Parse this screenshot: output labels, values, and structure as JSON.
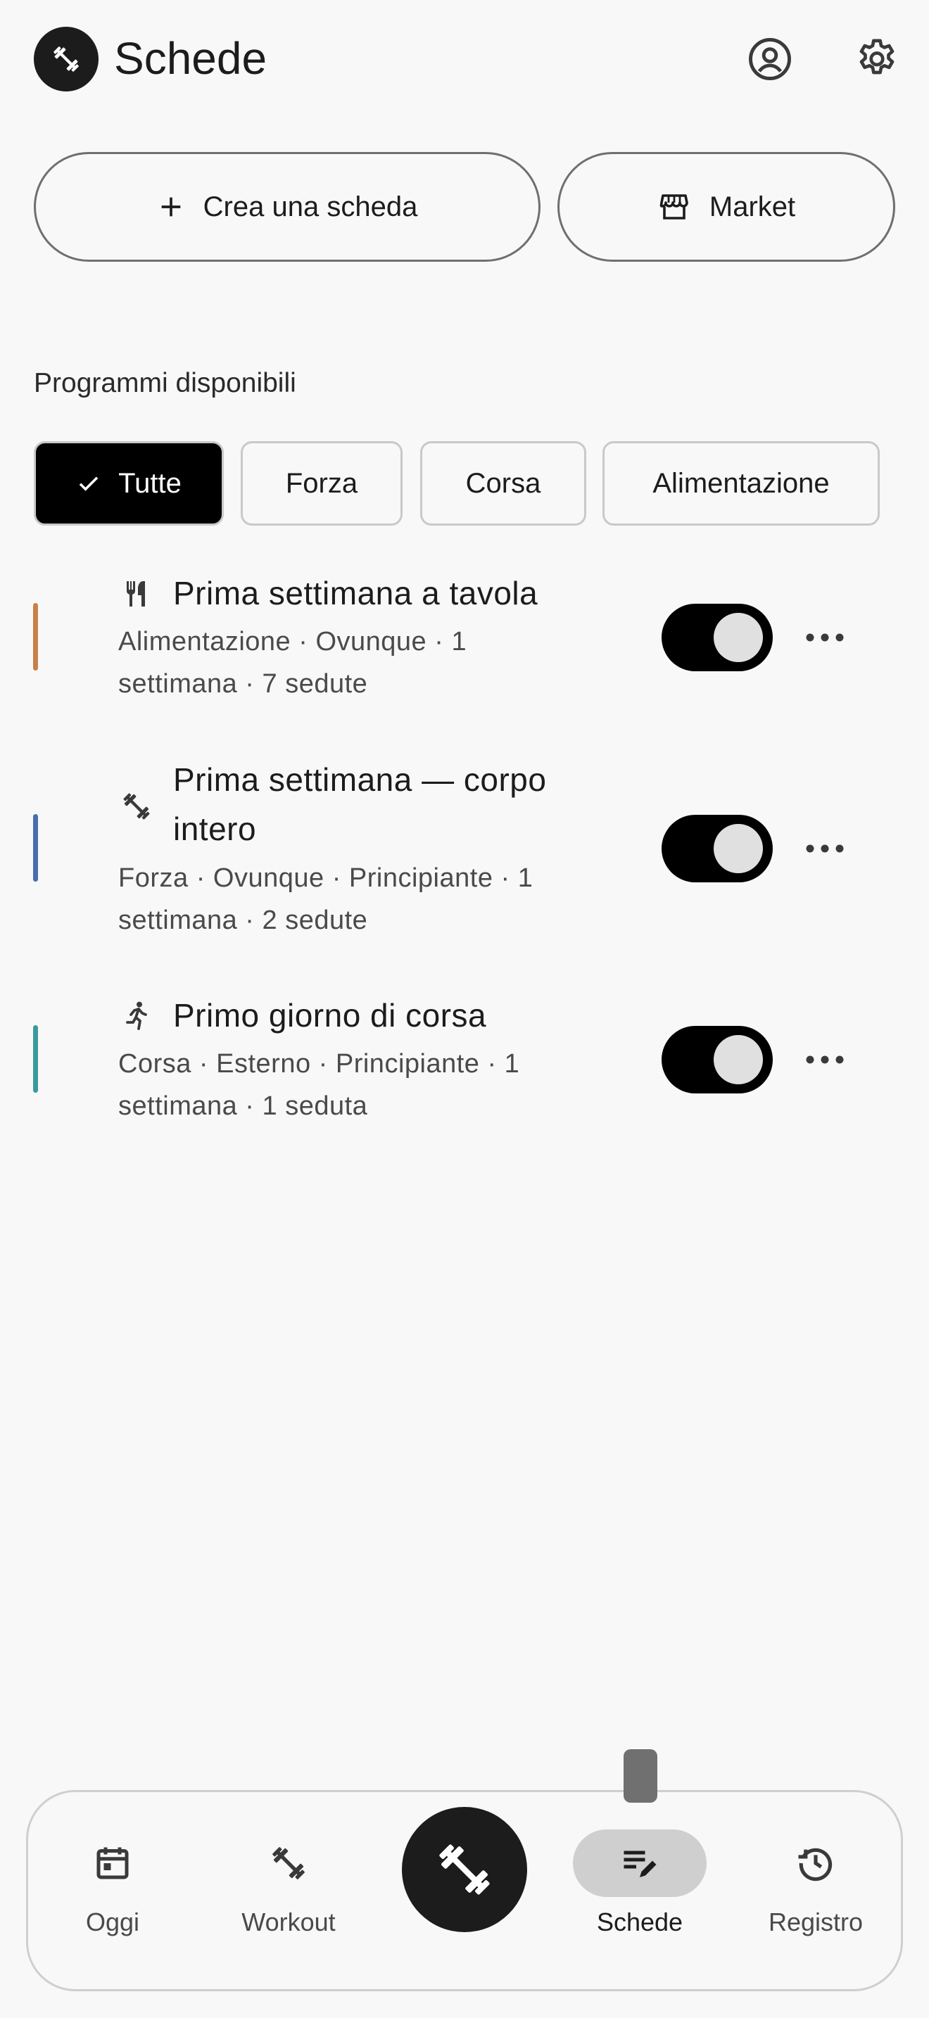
{
  "header": {
    "title": "Schede",
    "logo_icon": "dumbbell-icon",
    "profile_icon": "account-circle-icon",
    "settings_icon": "gear-icon"
  },
  "actions": {
    "create_label": "Crea una scheda",
    "create_icon": "plus-icon",
    "market_label": "Market",
    "market_icon": "storefront-icon"
  },
  "programs_section": {
    "label": "Programmi disponibili",
    "filters": [
      {
        "label": "Tutte",
        "selected": true
      },
      {
        "label": "Forza",
        "selected": false
      },
      {
        "label": "Corsa",
        "selected": false
      },
      {
        "label": "Alimentazione",
        "selected": false
      }
    ],
    "items": [
      {
        "icon": "fork-knife-icon",
        "title": "Prima settimana a tavola",
        "meta": "Alimentazione · Ovunque · 1 settimana · 7 sedute",
        "accent": "#c8804a",
        "enabled": true
      },
      {
        "icon": "dumbbell-icon",
        "title": "Prima settimana — corpo intero",
        "meta": "Forza · Ovunque · Principiante · 1 settimana · 2 sedute",
        "accent": "#4a6ea8",
        "enabled": true
      },
      {
        "icon": "running-icon",
        "title": "Primo giorno di corsa",
        "meta": "Corsa · Esterno · Principiante · 1 settimana · 1 seduta",
        "accent": "#3a9a9a",
        "enabled": true
      }
    ]
  },
  "bottom_nav": {
    "items": [
      {
        "label": "Oggi",
        "icon": "calendar-icon",
        "active": false
      },
      {
        "label": "Workout",
        "icon": "dumbbell-icon",
        "active": false
      },
      {
        "label": "Schede",
        "icon": "edit-list-icon",
        "active": true
      },
      {
        "label": "Registro",
        "icon": "history-icon",
        "active": false
      }
    ],
    "center_icon": "dumbbell-icon"
  },
  "colors": {
    "background": "#f8f8f8",
    "primary": "#000000",
    "active_pill": "#cfcfcf"
  }
}
